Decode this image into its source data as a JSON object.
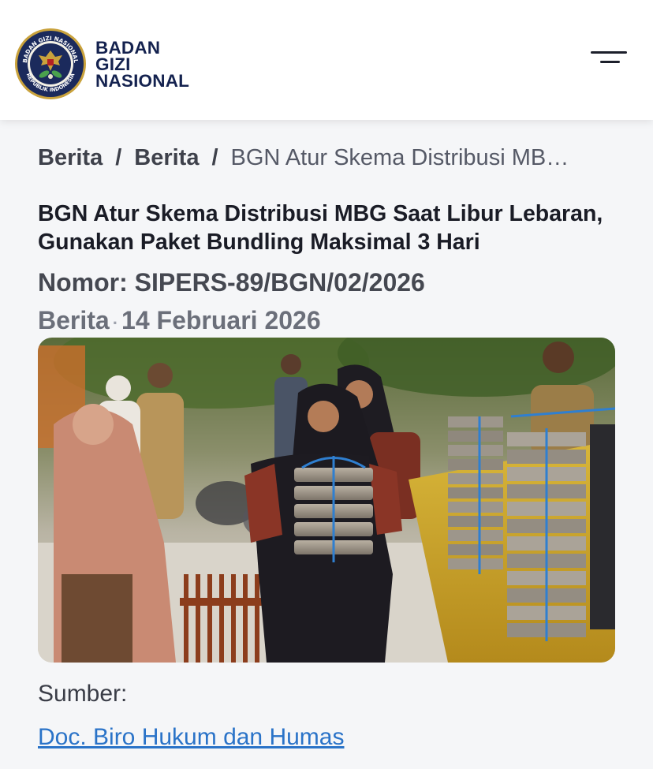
{
  "brand": {
    "lines": [
      "BADAN",
      "GIZI",
      "NASIONAL"
    ],
    "seal_ring_text_top": "BADAN GIZI NASIONAL",
    "seal_ring_text_bottom": "REPUBLIK INDONESIA",
    "colors": {
      "navy": "#14224f",
      "gold": "#c9a23c"
    }
  },
  "header": {
    "menu_icon": "hamburger-menu-icon"
  },
  "breadcrumb": {
    "items": [
      "Berita",
      "Berita"
    ],
    "separator": "/",
    "current": "BGN Atur Skema Distribusi MB…"
  },
  "article": {
    "title": "BGN Atur Skema Distribusi MBG Saat Libur Lebaran, Gunakan Paket Bundling Maksimal 3 Hari",
    "nomor": "Nomor: SIPERS-89/BGN/02/2026",
    "category": "Berita",
    "meta_separator": "·",
    "date": "14 Februari 2026",
    "image_description": "photo-students-carrying-stacked-meal-boxes",
    "source_label": "Sumber:",
    "source_link": "Doc. Biro Hukum dan Humas"
  },
  "colors": {
    "background": "#f5f6f8",
    "link": "#2a73c8",
    "text": "#1c1f2b"
  }
}
